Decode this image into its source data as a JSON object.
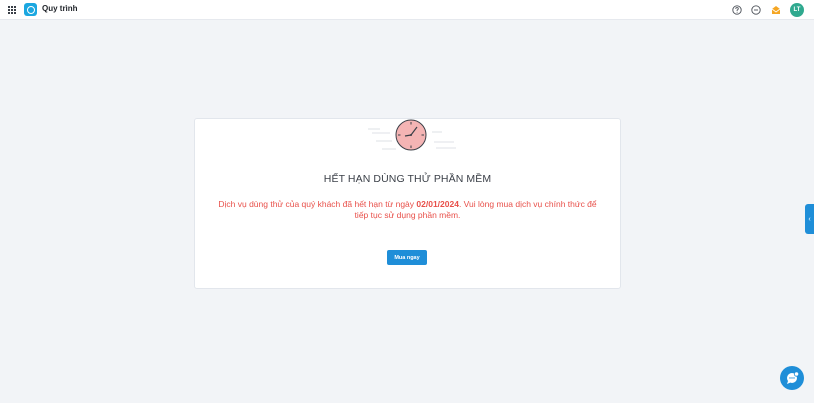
{
  "topbar": {
    "app_title": "Quy trình",
    "avatar_initials": "LT",
    "icons": [
      "apps-grid-icon",
      "app-logo-icon",
      "help-icon",
      "clock-icon",
      "mail-icon"
    ]
  },
  "card": {
    "title": "HẾT HẠN DÙNG THỬ PHẦN MỀM",
    "message_before": "Dịch vụ dùng thử của quý khách đã hết hạn từ ngày ",
    "expiry_date": "02/01/2024",
    "message_after": ". Vui lòng mua dịch vụ chính thức để tiếp tục sử dụng phần mềm.",
    "buy_button": "Mua ngay"
  },
  "colors": {
    "accent": "#1f8ed8",
    "logo": "#1ba7e0",
    "warning_text": "#e8504a",
    "avatar": "#2fa98f",
    "background": "#f2f4f7"
  }
}
